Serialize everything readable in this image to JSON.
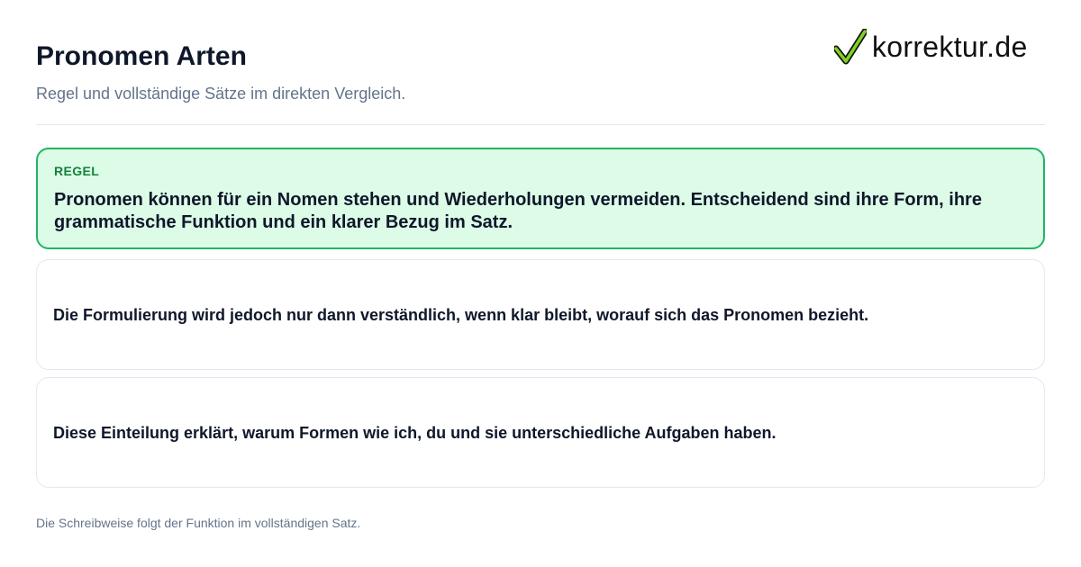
{
  "header": {
    "title": "Pronomen Arten",
    "subtitle": "Regel und vollständige Sätze im direkten Vergleich."
  },
  "logo": {
    "text": "korrektur.de",
    "icon": "checkmark-icon",
    "check_color": "#7ed321"
  },
  "rule": {
    "label": "REGEL",
    "text": "Pronomen können für ein Nomen stehen und Wiederholungen vermeiden. Entscheidend sind ihre Form, ihre grammatische Funktion und ein klarer Bezug im Satz."
  },
  "sentences": [
    {
      "text": "Die Formulierung wird jedoch nur dann verständlich, wenn klar bleibt, worauf sich das Pronomen bezieht."
    },
    {
      "text": "Diese Einteilung erklärt, warum Formen wie ich, du und sie unterschiedliche Aufgaben haben."
    }
  ],
  "footer": {
    "note": "Die Schreibweise folgt der Funktion im vollständigen Satz."
  },
  "colors": {
    "accent_green": "#22b565",
    "rule_background": "#dcfce7",
    "rule_label": "#15803d",
    "text_dark": "#0f172a",
    "text_muted": "#64748b"
  }
}
